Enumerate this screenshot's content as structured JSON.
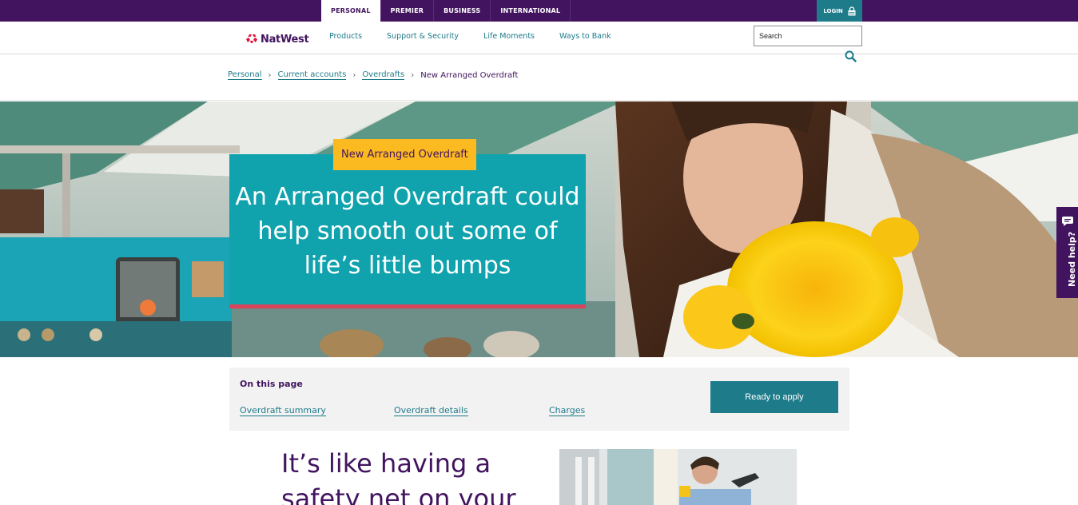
{
  "top_nav": {
    "tabs": [
      {
        "label": "PERSONAL",
        "active": true
      },
      {
        "label": "PREMIER",
        "active": false
      },
      {
        "label": "BUSINESS",
        "active": false
      },
      {
        "label": "INTERNATIONAL",
        "active": false
      }
    ],
    "login_label": "LOGIN"
  },
  "brand": {
    "name": "NatWest",
    "color": "#42145f",
    "logo_color": "#e0103a"
  },
  "main_nav": {
    "links": [
      "Products",
      "Support & Security",
      "Life Moments",
      "Ways to Bank"
    ],
    "search_placeholder": "Search"
  },
  "breadcrumb": {
    "items": [
      "Personal",
      "Current accounts",
      "Overdrafts"
    ],
    "current": "New Arranged Overdraft"
  },
  "hero": {
    "badge": "New Arranged Overdraft",
    "title": "An Arranged Overdraft could help smooth out some of life’s little bumps"
  },
  "need_help": {
    "label": "Need help?"
  },
  "on_this_page": {
    "heading": "On this page",
    "links": [
      "Overdraft summary",
      "Overdraft details",
      "Charges"
    ],
    "apply_label": "Ready to apply"
  },
  "lower": {
    "heading": "It’s like having a safety net on your"
  },
  "colors": {
    "purple": "#42145f",
    "teal": "#1d7b8a",
    "hero_card": "#10a2ad",
    "badge": "#fbba20",
    "accent_bar": "#d9445a"
  }
}
